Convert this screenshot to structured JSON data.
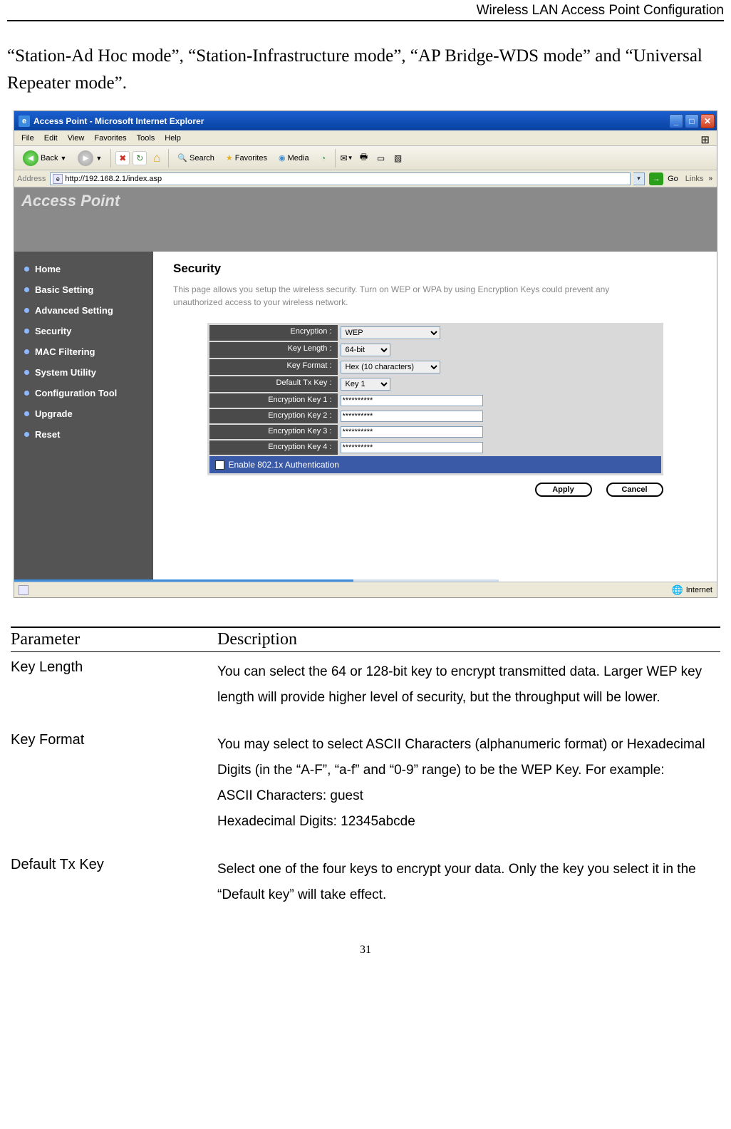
{
  "header": {
    "title": "Wireless LAN Access Point Configuration"
  },
  "intro": "“Station-Ad Hoc mode”, “Station-Infrastructure mode”, “AP Bridge-WDS mode” and “Universal Repeater mode”.",
  "browser": {
    "window_title": "Access Point - Microsoft Internet Explorer",
    "menu": {
      "file": "File",
      "edit": "Edit",
      "view": "View",
      "favorites": "Favorites",
      "tools": "Tools",
      "help": "Help"
    },
    "toolbar": {
      "back": "Back",
      "search": "Search",
      "favorites": "Favorites",
      "media": "Media"
    },
    "address_label": "Address",
    "address_value": "http://192.168.2.1/index.asp",
    "go": "Go",
    "links": "Links",
    "banner": "Access Point",
    "nav": [
      "Home",
      "Basic Setting",
      "Advanced Setting",
      "Security",
      "MAC Filtering",
      "System Utility",
      "Configuration Tool",
      "Upgrade",
      "Reset"
    ],
    "security": {
      "heading": "Security",
      "subtext": "This page allows you setup the wireless security. Turn on WEP or WPA by using Encryption Keys could prevent any unauthorized access to your wireless network.",
      "rows": {
        "encryption": {
          "label": "Encryption :",
          "value": "WEP"
        },
        "keylength": {
          "label": "Key Length :",
          "value": "64-bit"
        },
        "keyformat": {
          "label": "Key Format :",
          "value": "Hex (10 characters)"
        },
        "defaulttx": {
          "label": "Default Tx Key :",
          "value": "Key 1"
        },
        "key1": {
          "label": "Encryption Key 1 :",
          "value": "**********"
        },
        "key2": {
          "label": "Encryption Key 2 :",
          "value": "**********"
        },
        "key3": {
          "label": "Encryption Key 3 :",
          "value": "**********"
        },
        "key4": {
          "label": "Encryption Key 4 :",
          "value": "**********"
        }
      },
      "auth_label": "Enable 802.1x Authentication",
      "apply": "Apply",
      "cancel": "Cancel"
    },
    "status": "Internet"
  },
  "table": {
    "headers": {
      "param": "Parameter",
      "desc": "Description"
    },
    "rows": [
      {
        "name": "Key Length",
        "desc": "You can select the 64 or 128-bit key to encrypt transmitted data. Larger WEP key length will provide higher level of security, but the throughput will be lower."
      },
      {
        "name": "Key Format",
        "desc": "You may select to select ASCII Characters (alphanumeric format) or Hexadecimal Digits (in the “A-F”, “a-f” and “0-9” range) to be the WEP Key. For example:\nASCII Characters: guest\nHexadecimal Digits: 12345abcde"
      },
      {
        "name": "Default Tx Key",
        "desc": "Select one of the four keys to encrypt your data. Only the key you select it in the “Default key” will take effect."
      }
    ]
  },
  "page_number": "31"
}
